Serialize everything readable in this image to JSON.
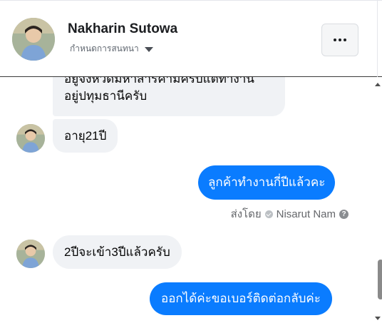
{
  "header": {
    "name": "Nakharin Sutowa",
    "status_label": "กำหนดการสนทนา"
  },
  "messages": [
    {
      "side": "in",
      "line1": "อยู่จังหวัดมหาสารคามครับแต่ทำงาน",
      "line2": "อยู่ปทุมธานีครับ"
    },
    {
      "side": "in",
      "text": "อายุ21ปี"
    },
    {
      "side": "out",
      "text": "ลูกค้าทำงานกี่ปีแล้วคะ"
    },
    {
      "side": "in",
      "text": "2ปีจะเข้า3ปีแล้วครับ"
    },
    {
      "side": "out",
      "text": "ออกได้ค่ะขอเบอร์ติดต่อกลับค่ะ"
    }
  ],
  "sent_by": {
    "label": "ส่งโดย",
    "agent": "Nisarut Nam"
  },
  "colors": {
    "outgoing": "#0a7cff",
    "incoming": "#f0f2f5"
  },
  "icons": [
    "more-icon",
    "chevron-down-icon",
    "verified-icon",
    "help-icon"
  ]
}
